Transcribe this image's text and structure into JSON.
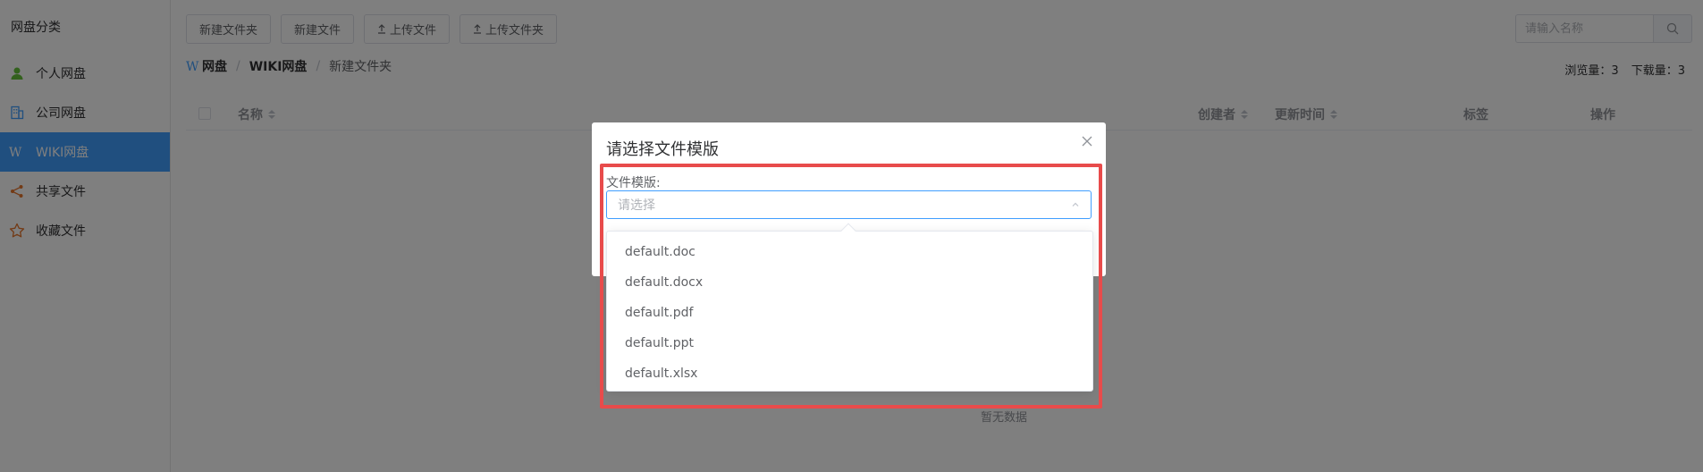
{
  "sidebar": {
    "title": "网盘分类",
    "items": [
      {
        "label": "个人网盘",
        "icon": "user-icon",
        "color": "#67c23a"
      },
      {
        "label": "公司网盘",
        "icon": "building-icon",
        "color": "#409eff"
      },
      {
        "label": "WIKI网盘",
        "icon": "wiki-w-icon",
        "color": "#ffffff",
        "active": true
      },
      {
        "label": "共享文件",
        "icon": "share-icon",
        "color": "#e6752b"
      },
      {
        "label": "收藏文件",
        "icon": "star-icon",
        "color": "#e6752b"
      }
    ]
  },
  "toolbar": {
    "new_folder": "新建文件夹",
    "new_file": "新建文件",
    "upload_file": "上传文件",
    "upload_folder": "上传文件夹"
  },
  "search": {
    "placeholder": "请输入名称"
  },
  "breadcrumb": {
    "root": "网盘",
    "level1": "WIKI网盘",
    "current": "新建文件夹"
  },
  "stats": {
    "views_label": "浏览量：",
    "views": "3",
    "downloads_label": "下载量：",
    "downloads": "3"
  },
  "table": {
    "columns": {
      "name": "名称",
      "creator": "创建者",
      "updated": "更新时间",
      "tags": "标签",
      "actions": "操作"
    },
    "empty_text": "暂无数据"
  },
  "dialog": {
    "title": "请选择文件模版",
    "field_label": "文件模版:",
    "select_placeholder": "请选择",
    "options": [
      "default.doc",
      "default.docx",
      "default.pdf",
      "default.ppt",
      "default.xlsx"
    ]
  },
  "colors": {
    "accent": "#409eff",
    "highlight": "#e84b4b"
  }
}
